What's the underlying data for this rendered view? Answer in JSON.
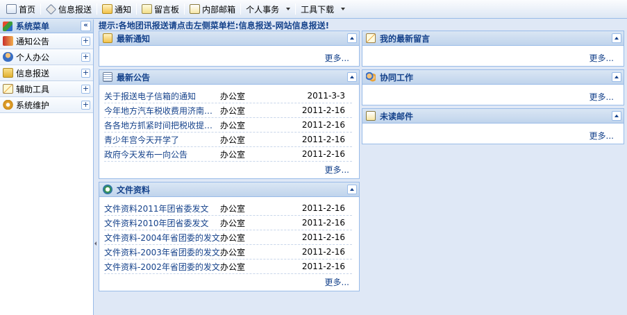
{
  "toolbar": {
    "items": [
      {
        "label": "首页",
        "icon": "home-icon"
      },
      {
        "label": "信息报送",
        "icon": "tag-icon"
      },
      {
        "label": "通知",
        "icon": "envelope-icon"
      },
      {
        "label": "留言板",
        "icon": "note-icon"
      },
      {
        "label": "内部邮箱",
        "icon": "mail-icon"
      },
      {
        "label": "个人事务",
        "icon": "chevron-down-icon"
      },
      {
        "label": "工具下载",
        "icon": "chevron-down-icon"
      }
    ]
  },
  "sidebar": {
    "title": "系统菜单",
    "collapse_glyph": "«",
    "expand_glyph": "+",
    "items": [
      {
        "label": "通知公告",
        "icon": "speaker-icon",
        "color": "#d9534f"
      },
      {
        "label": "个人办公",
        "icon": "user-icon",
        "color": "#e8a33a"
      },
      {
        "label": "信息报送",
        "icon": "folder-icon",
        "color": "#f0c040"
      },
      {
        "label": "辅助工具",
        "icon": "pencil-icon",
        "color": "#e8b84a"
      },
      {
        "label": "系统维护",
        "icon": "gear-icon",
        "color": "#e6a532"
      }
    ]
  },
  "hint": "提示:各地团讯报送请点击左侧菜单栏:信息报送-网站信息报送!",
  "more_label": "更多...",
  "panels": {
    "notice": {
      "title": "最新通知"
    },
    "announce": {
      "title": "最新公告",
      "rows": [
        {
          "title": "关于报送电子信箱的通知",
          "dept": "办公室",
          "date": "2011-3-3"
        },
        {
          "title": "今年地方汽车税收费用济南…",
          "dept": "办公室",
          "date": "2011-2-16"
        },
        {
          "title": "各各地方抓紧时间把税收提…",
          "dept": "办公室",
          "date": "2011-2-16"
        },
        {
          "title": "青少年宫今天开学了",
          "dept": "办公室",
          "date": "2011-2-16"
        },
        {
          "title": "政府今天发布一向公告",
          "dept": "办公室",
          "date": "2011-2-16"
        }
      ]
    },
    "files": {
      "title": "文件资料",
      "rows": [
        {
          "title": "文件资料2011年团省委发文",
          "dept": "办公室",
          "date": "2011-2-16"
        },
        {
          "title": "文件资料2010年团省委发文",
          "dept": "办公室",
          "date": "2011-2-16"
        },
        {
          "title": "文件资料-2004年省团委的发文",
          "dept": "办公室",
          "date": "2011-2-16"
        },
        {
          "title": "文件资料-2003年省团委的发文",
          "dept": "办公室",
          "date": "2011-2-16"
        },
        {
          "title": "文件资料-2002年省团委的发文",
          "dept": "办公室",
          "date": "2011-2-16"
        }
      ]
    },
    "messages": {
      "title": "我的最新留言"
    },
    "collab": {
      "title": "协同工作"
    },
    "unread": {
      "title": "未读邮件"
    }
  }
}
